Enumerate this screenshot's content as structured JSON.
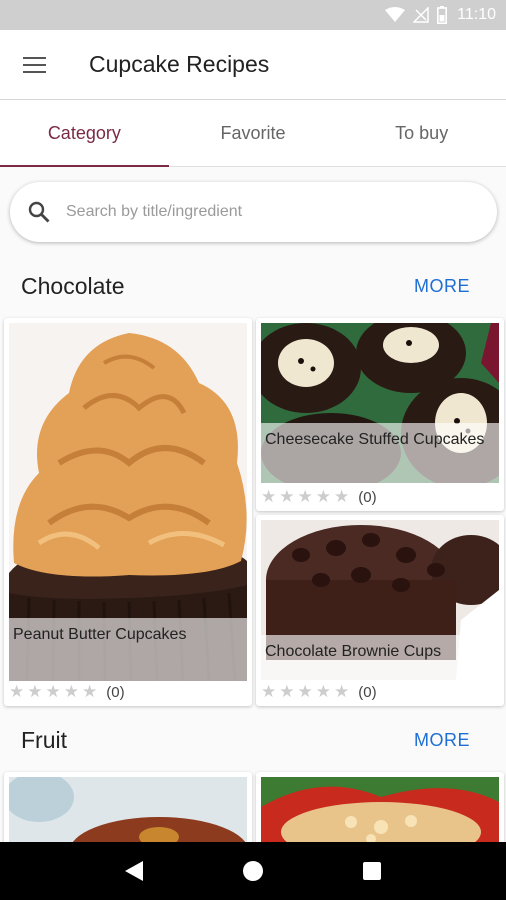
{
  "status_bar": {
    "time": "11:10",
    "icons": [
      "wifi-icon",
      "signal-icon",
      "battery-icon"
    ]
  },
  "app_bar": {
    "menu_icon": "menu-icon",
    "title": "Cupcake Recipes"
  },
  "tabs": [
    {
      "label": "Category",
      "active": true
    },
    {
      "label": "Favorite",
      "active": false
    },
    {
      "label": "To buy",
      "active": false
    }
  ],
  "search": {
    "icon": "search-icon",
    "placeholder": "Search by title/ingredient",
    "value": ""
  },
  "sections": [
    {
      "title": "Chocolate",
      "more_label": "MORE",
      "recipes": [
        {
          "title": "Peanut Butter Cupcakes",
          "rating_count": "(0)",
          "stars": 0
        },
        {
          "title": "Cheesecake Stuffed Cupcakes",
          "rating_count": "(0)",
          "stars": 0
        },
        {
          "title": "Chocolate Brownie Cups",
          "rating_count": "(0)",
          "stars": 0
        }
      ]
    },
    {
      "title": "Fruit",
      "more_label": "MORE",
      "recipes": []
    }
  ],
  "star_glyph": "★",
  "nav_bar": {
    "icons": [
      "back-icon",
      "home-icon",
      "recents-icon"
    ]
  },
  "colors": {
    "accent": "#7b2a45",
    "link": "#1f6ed4",
    "status_bar": "#cfcfcf"
  }
}
